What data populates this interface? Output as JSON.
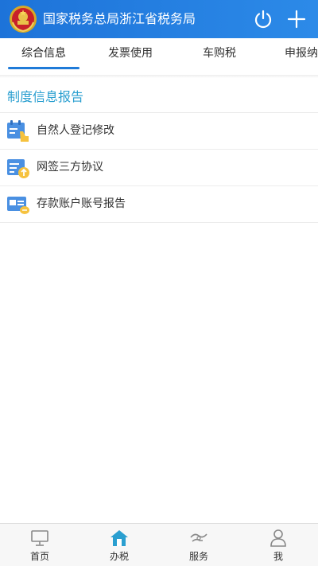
{
  "header": {
    "title": "国家税务总局浙江省税务局",
    "emblem_icon": "national-emblem-icon",
    "power_icon": "power-icon",
    "add_icon": "plus-icon",
    "background": "#1f7bd8"
  },
  "tabs": [
    {
      "label": "综合信息",
      "active": true
    },
    {
      "label": "发票使用",
      "active": false
    },
    {
      "label": "车购税",
      "active": false
    },
    {
      "label": "申报纳",
      "active": false
    }
  ],
  "section": {
    "title": "制度信息报告",
    "items": [
      {
        "label": "自然人登记修改",
        "icon": "person-registration-icon"
      },
      {
        "label": "网签三方协议",
        "icon": "agreement-upload-icon"
      },
      {
        "label": "存款账户账号报告",
        "icon": "tax-account-icon"
      }
    ]
  },
  "bottom_nav": [
    {
      "label": "首页",
      "icon": "monitor-icon",
      "active": false
    },
    {
      "label": "办税",
      "icon": "house-icon",
      "active": true
    },
    {
      "label": "服务",
      "icon": "handshake-icon",
      "active": false
    },
    {
      "label": "我",
      "icon": "user-icon",
      "active": false
    }
  ],
  "colors": {
    "accent": "#1f7bd8",
    "section_title": "#2a9fd0",
    "icon_yellow": "#f6c23e",
    "icon_blue": "#4a90e2"
  }
}
